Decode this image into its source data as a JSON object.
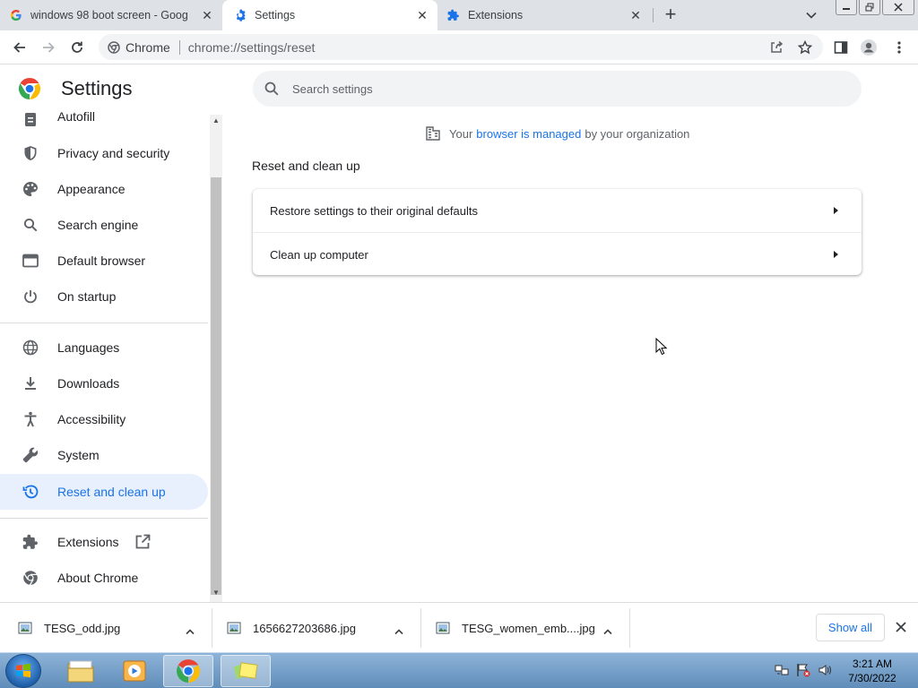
{
  "browser": {
    "tabs": [
      {
        "title": "windows 98 boot screen - Googl",
        "icon": "google-icon",
        "active": false
      },
      {
        "title": "Settings",
        "icon": "gear-icon",
        "active": true
      },
      {
        "title": "Extensions",
        "icon": "puzzle-icon",
        "active": false
      }
    ],
    "omnibox": {
      "site_chip": "Chrome",
      "url": "chrome://settings/reset"
    }
  },
  "settings": {
    "title": "Settings",
    "menu": [
      {
        "label": "Autofill",
        "icon": "clipboard-icon"
      },
      {
        "label": "Privacy and security",
        "icon": "shield-icon"
      },
      {
        "label": "Appearance",
        "icon": "palette-icon"
      },
      {
        "label": "Search engine",
        "icon": "search-icon"
      },
      {
        "label": "Default browser",
        "icon": "browser-window-icon"
      },
      {
        "label": "On startup",
        "icon": "power-icon"
      },
      {
        "label": "Languages",
        "icon": "globe-icon"
      },
      {
        "label": "Downloads",
        "icon": "download-icon"
      },
      {
        "label": "Accessibility",
        "icon": "accessibility-icon"
      },
      {
        "label": "System",
        "icon": "wrench-icon"
      },
      {
        "label": "Reset and clean up",
        "icon": "history-icon",
        "selected": true
      },
      {
        "label": "Extensions",
        "icon": "puzzle-icon"
      },
      {
        "label": "About Chrome",
        "icon": "chrome-icon"
      }
    ],
    "search": {
      "placeholder": "Search settings"
    },
    "managed": {
      "prefix": "Your",
      "link": "browser is managed",
      "suffix": "by your organization"
    },
    "section_title": "Reset and clean up",
    "rows": [
      {
        "label": "Restore settings to their original defaults"
      },
      {
        "label": "Clean up computer"
      }
    ]
  },
  "downloads": {
    "items": [
      {
        "name": "TESG_odd.jpg"
      },
      {
        "name": "1656627203686.jpg"
      },
      {
        "name": "TESG_women_emb....jpg"
      }
    ],
    "show_all": "Show all"
  },
  "taskbar": {
    "time": "3:21 AM",
    "date": "7/30/2022"
  },
  "colors": {
    "accent": "#1a73e8",
    "selected_bg": "#e8f0fe"
  }
}
